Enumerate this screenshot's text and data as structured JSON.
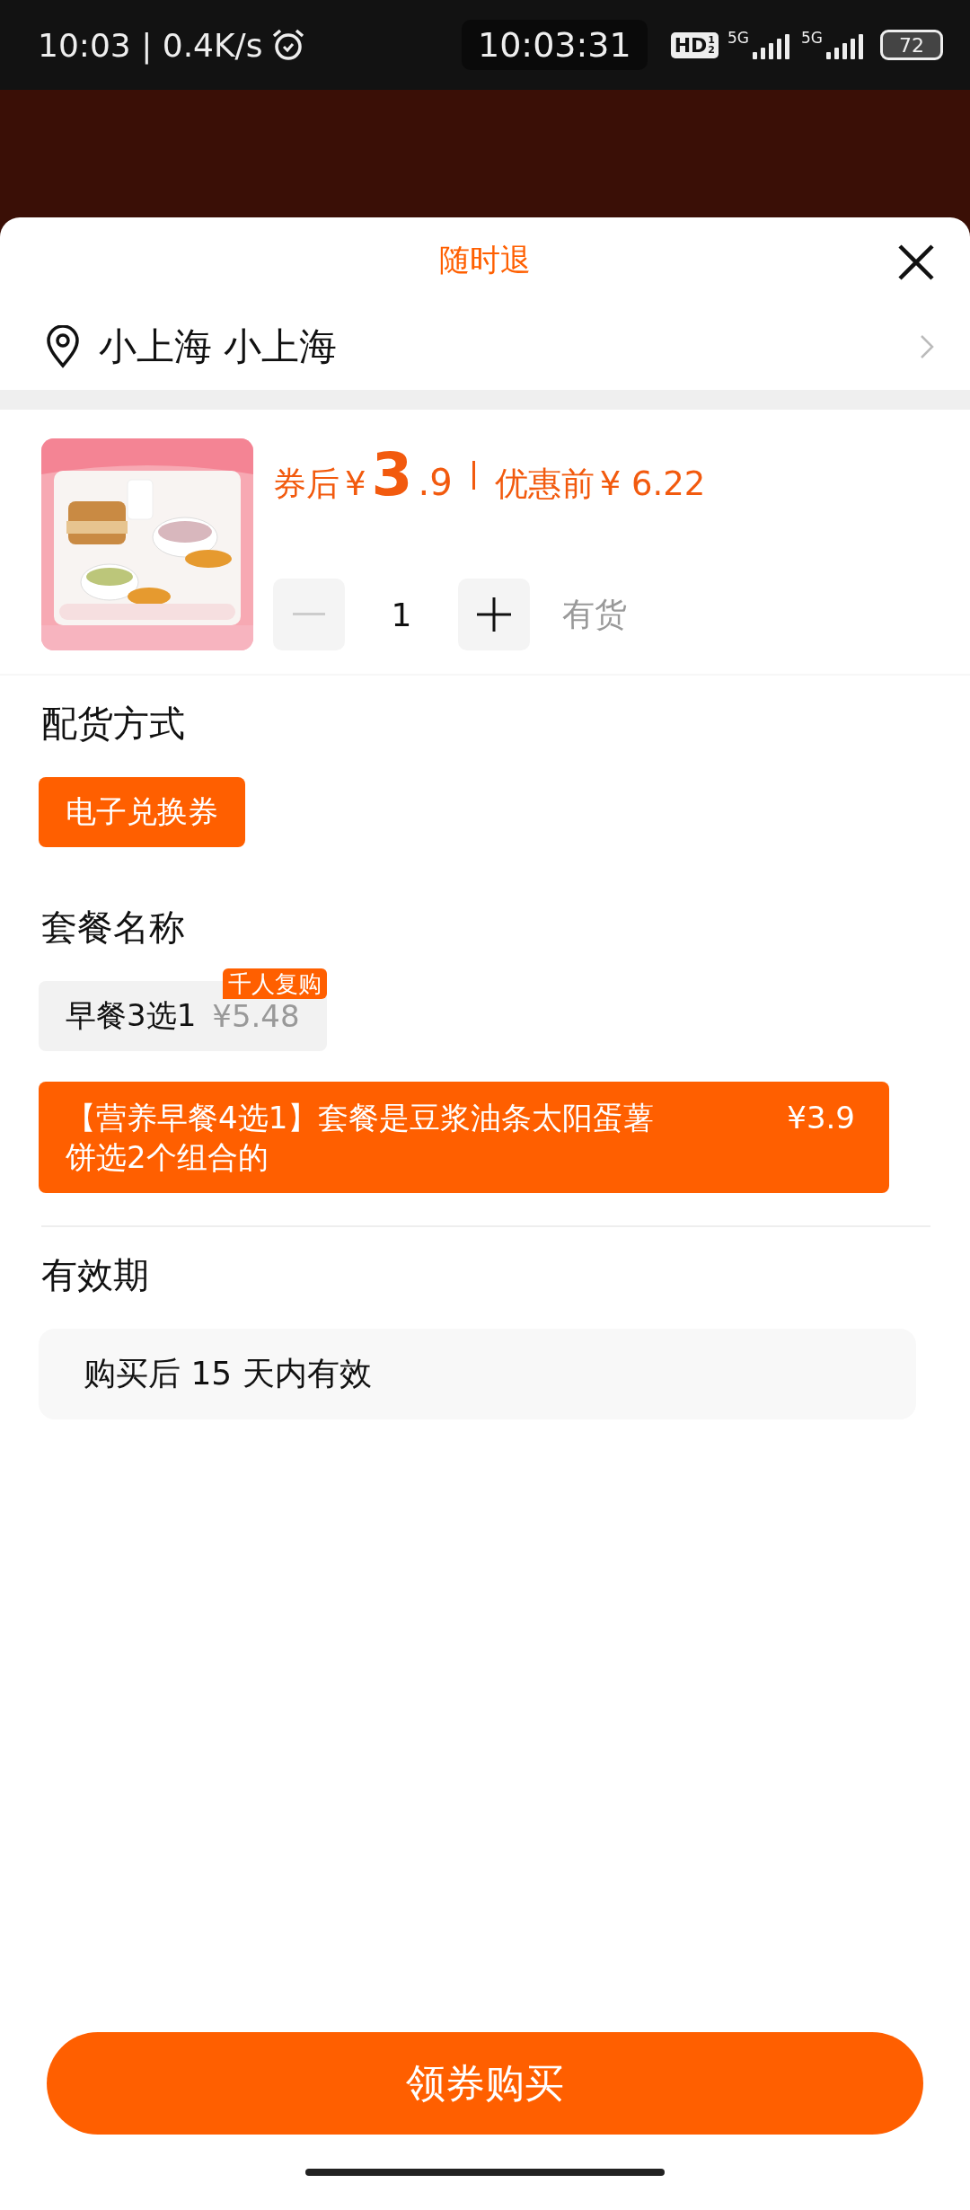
{
  "status_bar": {
    "time_speed": "10:03 | 0.4K/s",
    "clock": "10:03:31",
    "hd": "HD",
    "hd_sub": [
      "1",
      "2"
    ],
    "networks": [
      "5G",
      "5G"
    ],
    "battery": "72"
  },
  "sheet": {
    "title": "随时退",
    "location": "小上海 小上海",
    "product": {
      "after_label": "券后",
      "currency": "¥",
      "price_int": "3",
      "price_dec": ".9",
      "before_label": "优惠前",
      "before_price": "¥ 6.22",
      "quantity": "1",
      "minus_disabled": true,
      "stock": "有货"
    },
    "sections": [
      {
        "kind": "chips",
        "heading": "配货方式",
        "options": [
          {
            "label": "电子兑换券",
            "selected": true
          }
        ]
      },
      {
        "kind": "packages",
        "heading": "套餐名称",
        "options": [
          {
            "label": "早餐3选1",
            "price": "¥5.48",
            "badge": "千人复购",
            "selected": false
          },
          {
            "label": "【营养早餐4选1】套餐是豆浆油条太阳蛋薯饼选2个组合的",
            "price": "¥3.9",
            "selected": true
          }
        ]
      },
      {
        "kind": "info",
        "heading": "有效期",
        "text": "购买后 15 天内有效"
      }
    ]
  },
  "buy_button": "领券购买"
}
